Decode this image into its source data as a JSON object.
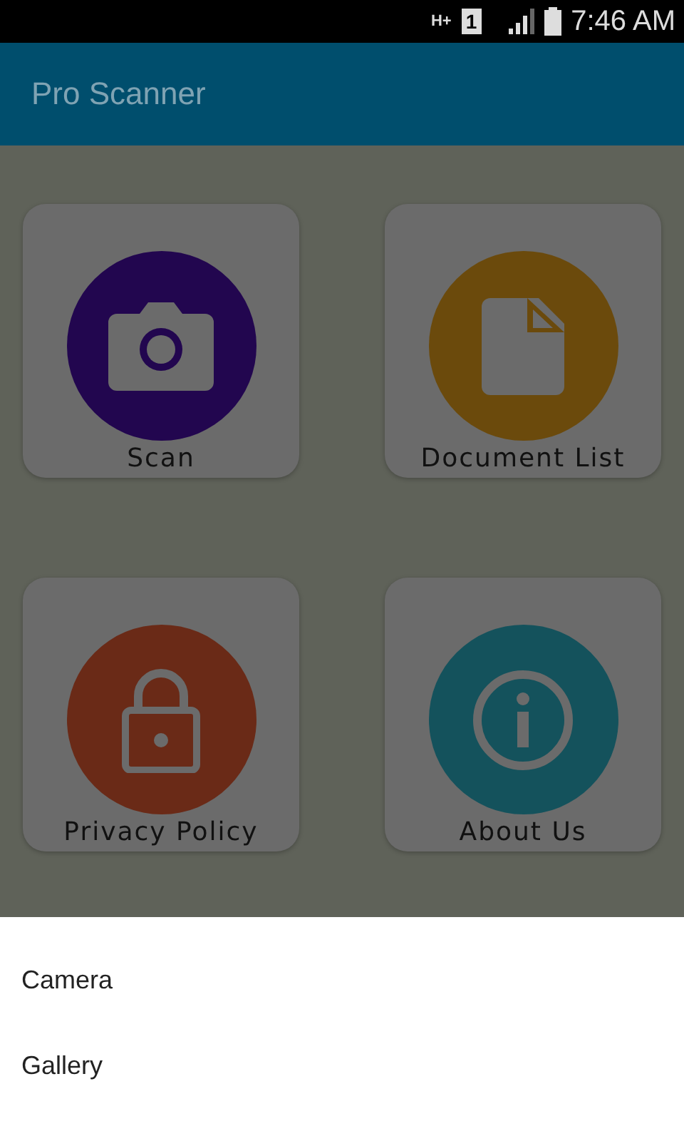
{
  "status_bar": {
    "network": "H+",
    "sim": "1",
    "time": "7:46 AM"
  },
  "app_bar": {
    "title": "Pro Scanner"
  },
  "tiles": [
    {
      "label": "Scan",
      "kind": "camera",
      "color": "#22064f"
    },
    {
      "label": "Document List",
      "kind": "document",
      "color": "#6b4a0c"
    },
    {
      "label": "Privacy Policy",
      "kind": "lock",
      "color": "#6a2a17"
    },
    {
      "label": "About Us",
      "kind": "info",
      "color": "#14525c"
    }
  ],
  "sheet": {
    "items": [
      "Camera",
      "Gallery"
    ]
  }
}
